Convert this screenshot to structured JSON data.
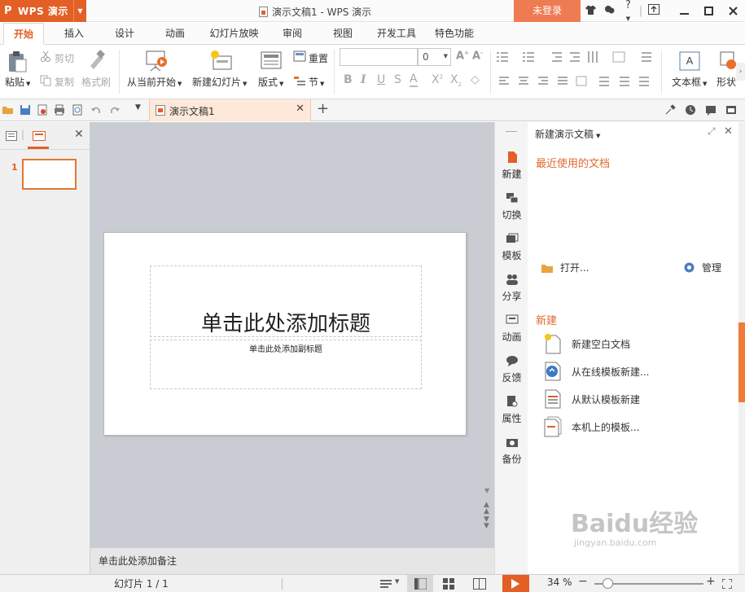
{
  "titlebar": {
    "app_name": "WPS 演示",
    "logo": "P",
    "doc_title": "演示文稿1 - WPS 演示",
    "login": "未登录",
    "icons": [
      "shirt-icon",
      "skin-icon",
      "help-icon",
      "export-icon"
    ],
    "help": "?",
    "window_controls": [
      "minimize-icon",
      "maximize-icon",
      "close-icon"
    ]
  },
  "menu": {
    "tabs": [
      "开始",
      "插入",
      "设计",
      "动画",
      "幻灯片放映",
      "审阅",
      "视图",
      "开发工具",
      "特色功能"
    ],
    "active": "开始"
  },
  "ribbon": {
    "paste": "粘贴",
    "cut": "剪切",
    "copy": "复制",
    "format_painter": "格式刷",
    "from_current": "从当前开始",
    "new_slide": "新建幻灯片",
    "layout": "版式",
    "reset": "重置",
    "section": "节",
    "font_size": "0",
    "textbox": "文本框",
    "shape": "形状"
  },
  "doc_tab": {
    "label": "演示文稿1"
  },
  "slide_panel": {
    "slide_number": "1"
  },
  "slide": {
    "title_placeholder": "单击此处添加标题",
    "subtitle_placeholder": "单击此处添加副标题"
  },
  "notes": {
    "placeholder": "单击此处添加备注"
  },
  "sidebar": {
    "items": [
      "新建",
      "切换",
      "模板",
      "分享",
      "动画",
      "反馈",
      "属性",
      "备份"
    ]
  },
  "taskpane": {
    "title": "新建演示文稿",
    "recent": "最近使用的文档",
    "open": "打开...",
    "manage": "管理",
    "new_section": "新建",
    "new_items": [
      "新建空白文档",
      "从在线模板新建...",
      "从默认模板新建",
      "本机上的模板..."
    ]
  },
  "statusbar": {
    "slide_pos": "幻灯片 1 / 1",
    "zoom": "34 %",
    "zoom_level": 0.34
  },
  "watermark": {
    "brand": "Baidu经验",
    "url": "jingyan.baidu.com"
  },
  "colors": {
    "accent": "#e35f26",
    "login": "#ef7b53",
    "canvas": "#c9cdd3"
  }
}
